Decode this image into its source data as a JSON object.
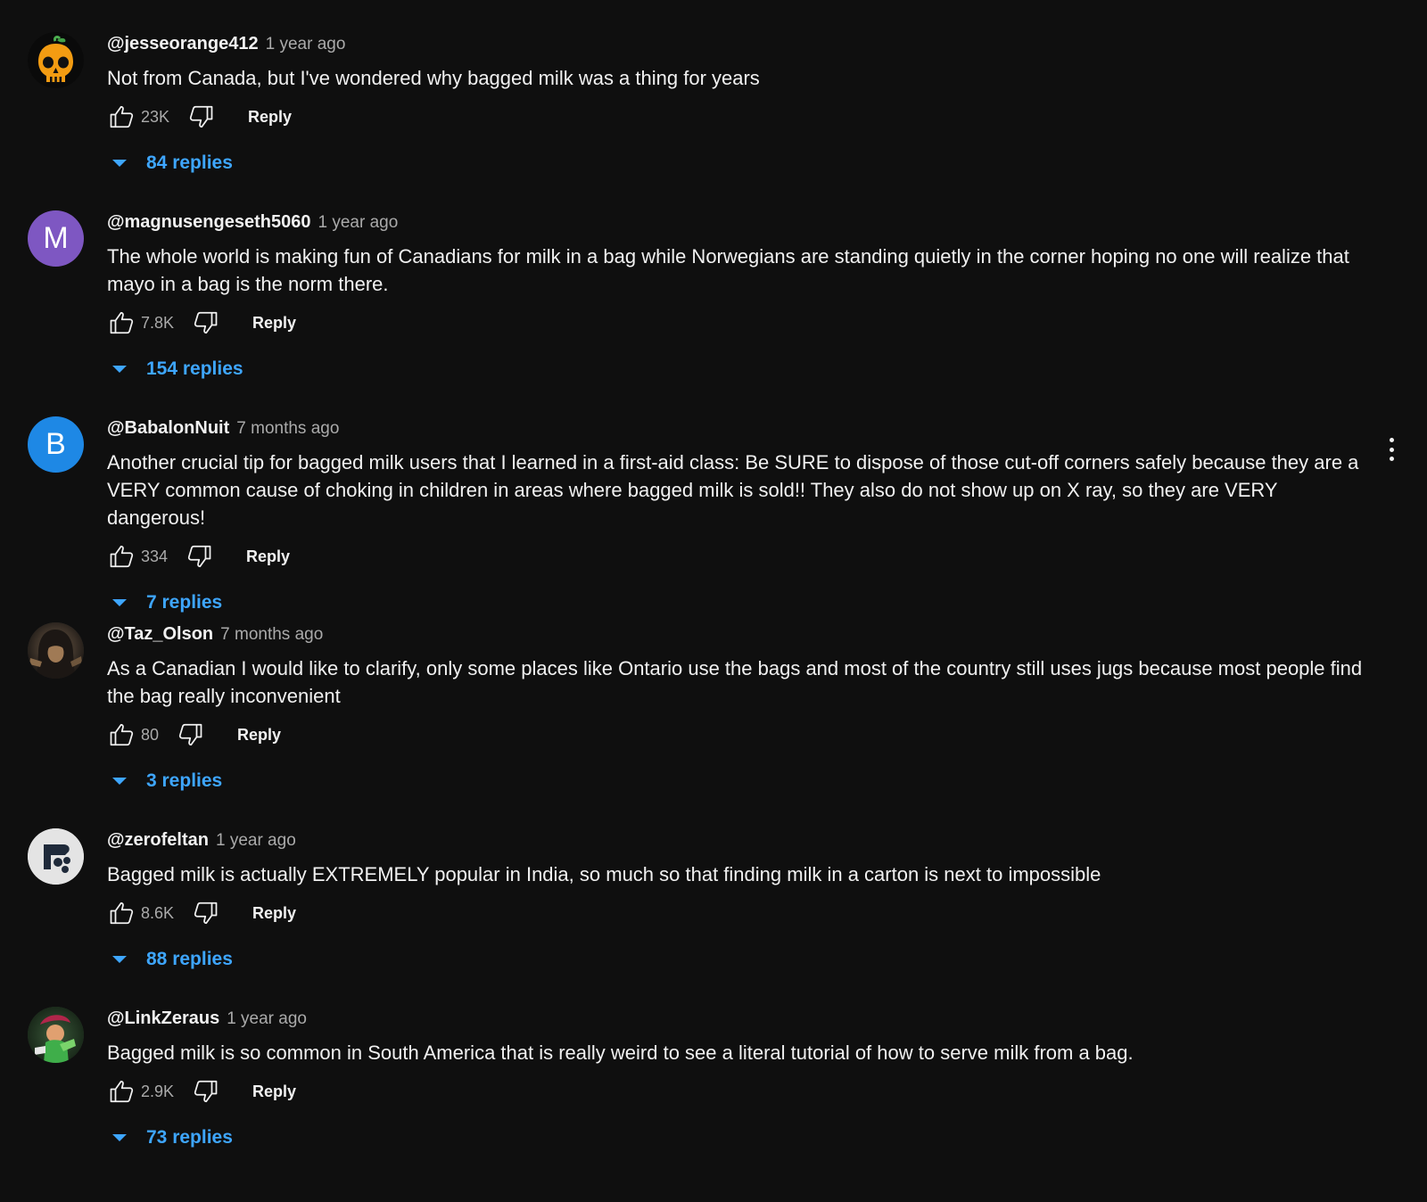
{
  "comments": [
    {
      "author": "@jesseorange412",
      "time": "1 year ago",
      "text": "Not from Canada, but I've wondered why bagged milk was a thing for years",
      "likes": "23K",
      "reply_label": "Reply",
      "replies_label": "84 replies",
      "avatar": {
        "type": "image",
        "icon": "orange-skull-icon"
      }
    },
    {
      "author": "@magnusengeseth5060",
      "time": "1 year ago",
      "text": "The whole world is making fun of Canadians for milk in a bag while Norwegians are standing quietly in the corner hoping no one will realize that mayo in a bag is the norm there.",
      "likes": "7.8K",
      "reply_label": "Reply",
      "replies_label": "154 replies",
      "avatar": {
        "type": "letter",
        "letter": "M",
        "color": "#7e57c2"
      }
    },
    {
      "author": "@BabalonNuit",
      "time": "7 months ago",
      "text": "Another crucial tip for bagged milk users that I learned in a first-aid class: Be SURE to dispose of those cut-off corners safely because they are a VERY common cause of choking in children in areas where bagged milk is sold!! They also do not show up on X ray, so they are VERY dangerous!",
      "likes": "334",
      "reply_label": "Reply",
      "replies_label": "7 replies",
      "avatar": {
        "type": "letter",
        "letter": "B",
        "color": "#1e88e5"
      }
    },
    {
      "author": "@Taz_Olson",
      "time": "7 months ago",
      "text": "As a Canadian I would like to clarify, only some places like Ontario use the bags and most of the country still uses jugs because most people find the bag really inconvenient",
      "likes": "80",
      "reply_label": "Reply",
      "replies_label": "3 replies",
      "avatar": {
        "type": "image",
        "icon": "hooded-figure-icon"
      }
    },
    {
      "author": "@zerofeltan",
      "time": "1 year ago",
      "text": "Bagged milk is actually EXTREMELY popular in India, so much so that finding milk in a carton is next to impossible",
      "likes": "8.6K",
      "reply_label": "Reply",
      "replies_label": "88 replies",
      "avatar": {
        "type": "image",
        "icon": "logo-icon"
      }
    },
    {
      "author": "@LinkZeraus",
      "time": "1 year ago",
      "text": "Bagged milk is so common in South America that is really weird to see a literal tutorial of how to serve milk from a bag.",
      "likes": "2.9K",
      "reply_label": "Reply",
      "replies_label": "73 replies",
      "avatar": {
        "type": "image",
        "icon": "character-icon"
      }
    }
  ],
  "colors": {
    "background": "#0f0f0f",
    "text": "#f1f1f1",
    "secondary_text": "#aaaaaa",
    "link": "#3ea6ff"
  }
}
